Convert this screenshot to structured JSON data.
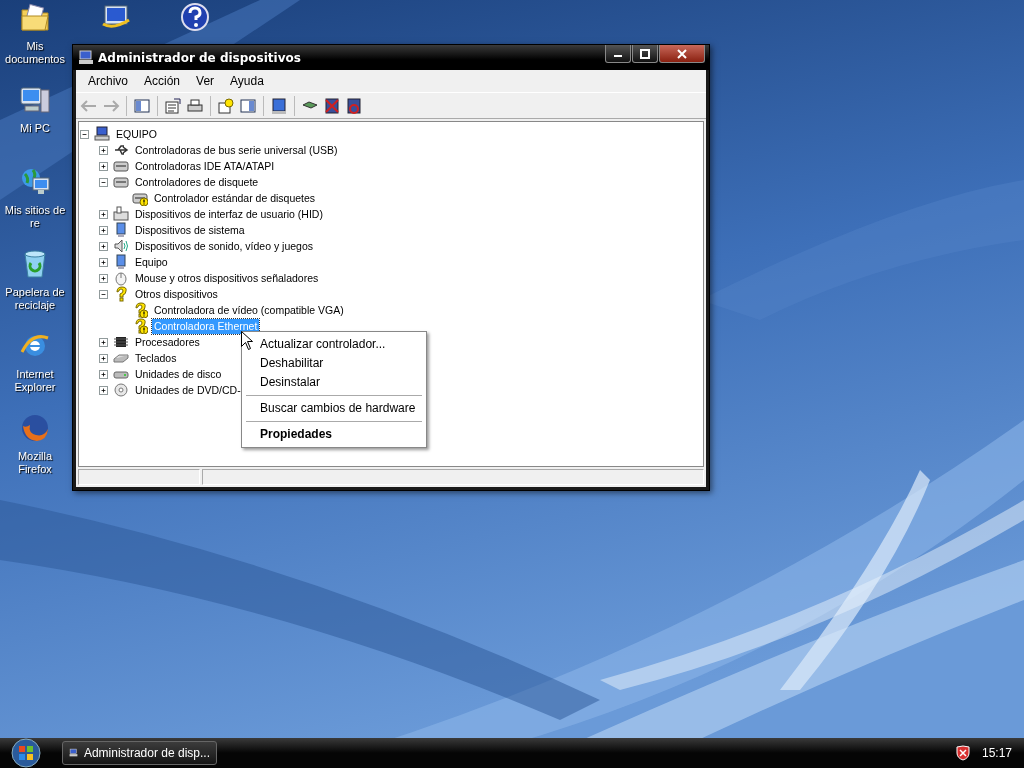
{
  "desktop_icons": [
    {
      "label": "Mis documentos",
      "kind": "folder"
    },
    {
      "label": "Mi PC",
      "kind": "computer"
    },
    {
      "label": "Mis sitios de re",
      "kind": "network"
    },
    {
      "label": "Papelera de reciclaje",
      "kind": "bin"
    },
    {
      "label": "Internet Explorer",
      "kind": "ie"
    },
    {
      "label": "Mozilla Firefox",
      "kind": "firefox"
    }
  ],
  "window": {
    "title": "Administrador de dispositivos",
    "menu": [
      "Archivo",
      "Acción",
      "Ver",
      "Ayuda"
    ],
    "tree": [
      {
        "label": "EQUIPO",
        "kind": "computer",
        "expanded": true,
        "selected": false,
        "children": [
          {
            "label": "Controladoras de bus serie universal (USB)",
            "kind": "usb",
            "expanded": false,
            "selected": false
          },
          {
            "label": "Controladoras IDE ATA/ATAPI",
            "kind": "drive",
            "expanded": false,
            "selected": false
          },
          {
            "label": "Controladores de disquete",
            "kind": "drive",
            "expanded": true,
            "selected": false,
            "children": [
              {
                "label": "Controlador estándar de disquetes",
                "kind": "drive",
                "warning": true,
                "selected": false
              }
            ]
          },
          {
            "label": "Dispositivos de interfaz de usuario (HID)",
            "kind": "hid",
            "expanded": false,
            "selected": false
          },
          {
            "label": "Dispositivos de sistema",
            "kind": "monitor",
            "expanded": false,
            "selected": false
          },
          {
            "label": "Dispositivos de sonido, vídeo y juegos",
            "kind": "sound",
            "expanded": false,
            "selected": false
          },
          {
            "label": "Equipo",
            "kind": "monitor",
            "expanded": false,
            "selected": false
          },
          {
            "label": "Mouse y otros dispositivos señaladores",
            "kind": "mouse",
            "expanded": false,
            "selected": false
          },
          {
            "label": "Otros dispositivos",
            "kind": "unknown",
            "expanded": true,
            "selected": false,
            "children": [
              {
                "label": "Controladora de vídeo (compatible VGA)",
                "kind": "unknown",
                "warning": true,
                "selected": false
              },
              {
                "label": "Controladora Ethernet",
                "kind": "unknown",
                "warning": true,
                "selected": true
              }
            ]
          },
          {
            "label": "Procesadores",
            "kind": "cpu",
            "expanded": false,
            "selected": false
          },
          {
            "label": "Teclados",
            "kind": "keyboard",
            "expanded": false,
            "selected": false
          },
          {
            "label": "Unidades de disco",
            "kind": "disk",
            "expanded": false,
            "selected": false
          },
          {
            "label": "Unidades de DVD/CD-",
            "kind": "dvd",
            "expanded": false,
            "selected": false
          }
        ]
      }
    ]
  },
  "context_menu": [
    {
      "kind": "item",
      "label": "Actualizar controlador...",
      "default": false
    },
    {
      "kind": "item",
      "label": "Deshabilitar",
      "default": false
    },
    {
      "kind": "item",
      "label": "Desinstalar",
      "default": false
    },
    {
      "kind": "separator"
    },
    {
      "kind": "item",
      "label": "Buscar cambios de hardware",
      "default": false
    },
    {
      "kind": "separator"
    },
    {
      "kind": "item",
      "label": "Propiedades",
      "default": true
    }
  ],
  "taskbar": {
    "task": "Administrador de disp...",
    "clock": "15:17"
  }
}
